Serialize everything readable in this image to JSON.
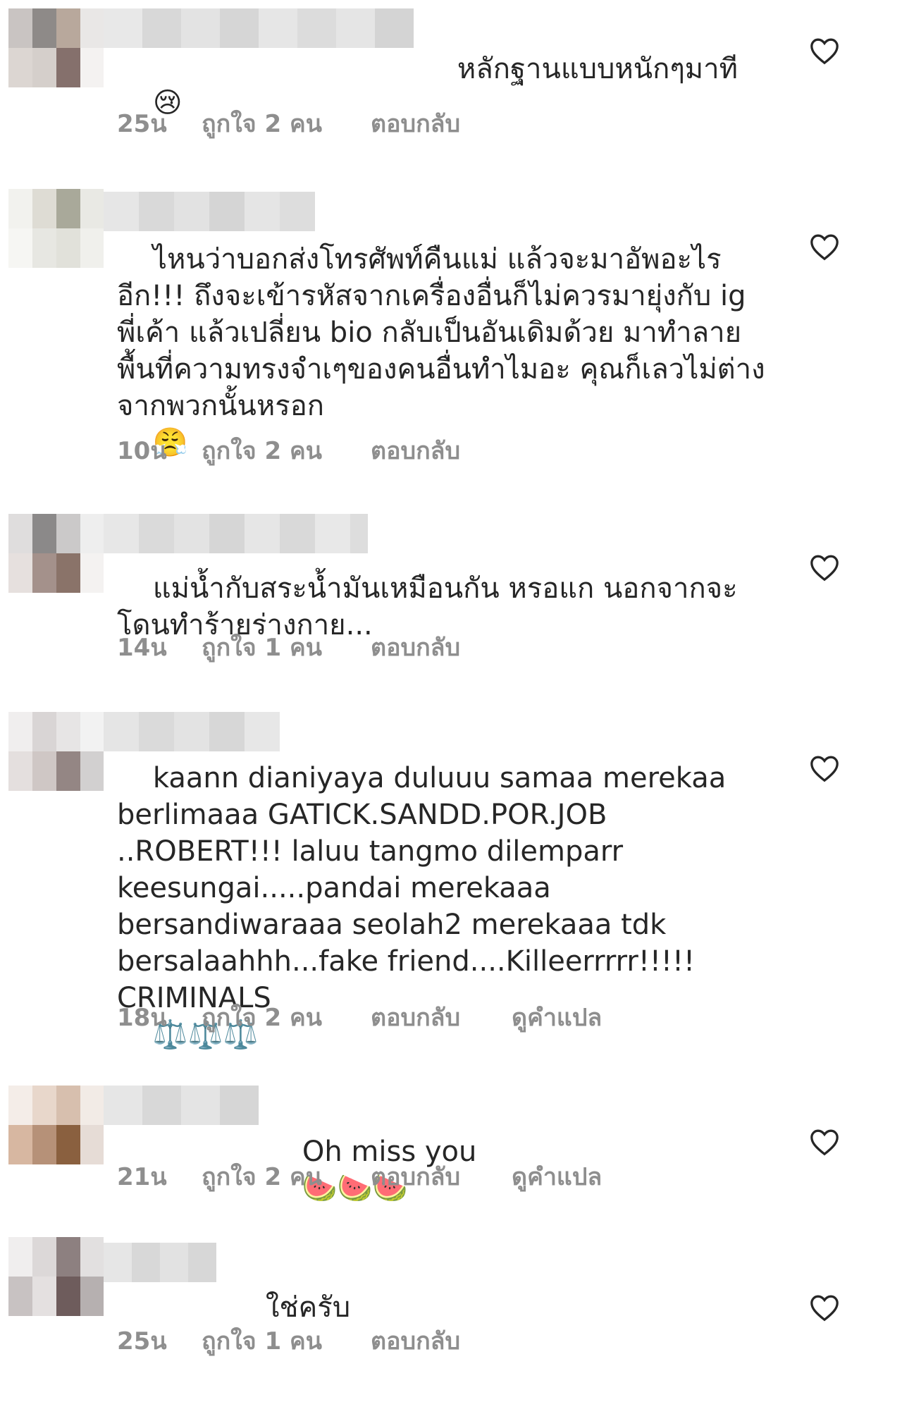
{
  "comments": [
    {
      "text": "หลักฐานแบบหนักๆมาที",
      "emoji": "😢",
      "time": "25น",
      "likes": "ถูกใจ 2 คน",
      "reply": "ตอบกลับ",
      "translate": ""
    },
    {
      "text": "ไหนว่าบอกส่งโทรศัพท์คืนแม่ แล้วจะมาอัพอะไรอีก!!! ถึงจะเข้ารหัสจากเครื่องอื่นก็ไม่ควรมายุ่งกับ ig พี่เค้า แล้วเปลี่ยน bio กลับเป็นอันเดิมด้วย มาทำลายพื้นที่ความทรงจำเๆของคนอื่นทำไมอะ คุณก็เลวไม่ต่างจากพวกนั้นหรอก",
      "emoji": "😤",
      "time": "10น",
      "likes": "ถูกใจ 2 คน",
      "reply": "ตอบกลับ",
      "translate": ""
    },
    {
      "text": "แม่น้ำกับสระน้ำมันเหมือนกัน หรอแก นอกจากจะโดนทำร้ายร่างกาย...",
      "emoji": "",
      "time": "14น",
      "likes": "ถูกใจ 1 คน",
      "reply": "ตอบกลับ",
      "translate": ""
    },
    {
      "text": "kaann dianiyaya duluuu samaa merekaa berlimaaa GATICK.SANDD.POR.JOB ..ROBERT!!! laluu tangmo dilemparr keesungai.....pandai merekaaa bersandiwaraaa seolah2 merekaaa tdk bersalaahhh...fake friend....Killeerrrrr!!!!! CRIMINALS",
      "emoji": "⚖️⚖️⚖️",
      "time": "18น",
      "likes": "ถูกใจ 2 คน",
      "reply": "ตอบกลับ",
      "translate": "ดูคำแปล"
    },
    {
      "text": "Oh miss you",
      "emoji": "🍉🍉🍉",
      "time": "21น",
      "likes": "ถูกใจ 2 คน",
      "reply": "ตอบกลับ",
      "translate": "ดูคำแปล"
    },
    {
      "text": "ใช่ครับ",
      "emoji": "",
      "time": "25น",
      "likes": "ถูกใจ 1 คน",
      "reply": "ตอบกลับ",
      "translate": ""
    }
  ],
  "colors": {
    "text": "#262626",
    "meta": "#8e8e8e",
    "heart": "#262626"
  },
  "icons": {
    "heart": "heart-outline-icon"
  }
}
